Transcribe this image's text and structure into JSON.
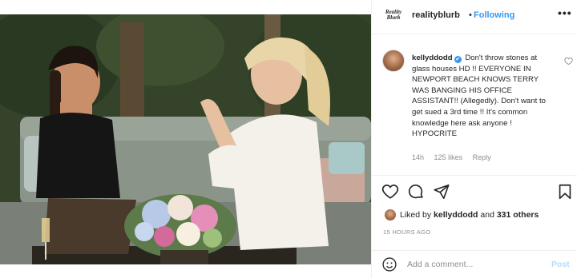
{
  "header": {
    "brand_line1": "Reality",
    "brand_line2": "Blurb",
    "username": "realityblurb",
    "separator": "•",
    "follow_label": "Following",
    "more_label": "•••"
  },
  "comment": {
    "username": "kellyddodd",
    "verified_icon": "✔",
    "text": "Don't throw stones at glass houses HD !! EVERYONE IN NEWPORT BEACH KNOWS TERRY WAS BANGING HIS OFFICE ASSISTANT!! (Allegedly). Don't want to get sued a 3rd time !! It's common knowledge here ask anyone ! HYPOCRITE",
    "age": "14h",
    "likes": "125 likes",
    "reply_label": "Reply"
  },
  "actions": {
    "icons": [
      "heart-icon",
      "comment-icon",
      "share-icon",
      "bookmark-icon"
    ]
  },
  "likes": {
    "prefix": "Liked by ",
    "user": "kellyddodd",
    "middle": " and ",
    "others": "331 others"
  },
  "timestamp": "15 HOURS AGO",
  "add_comment": {
    "placeholder": "Add a comment...",
    "post_label": "Post"
  },
  "colors": {
    "accent": "#3897f0",
    "muted": "#8e8e8e",
    "post_disabled": "#b3dbff"
  }
}
